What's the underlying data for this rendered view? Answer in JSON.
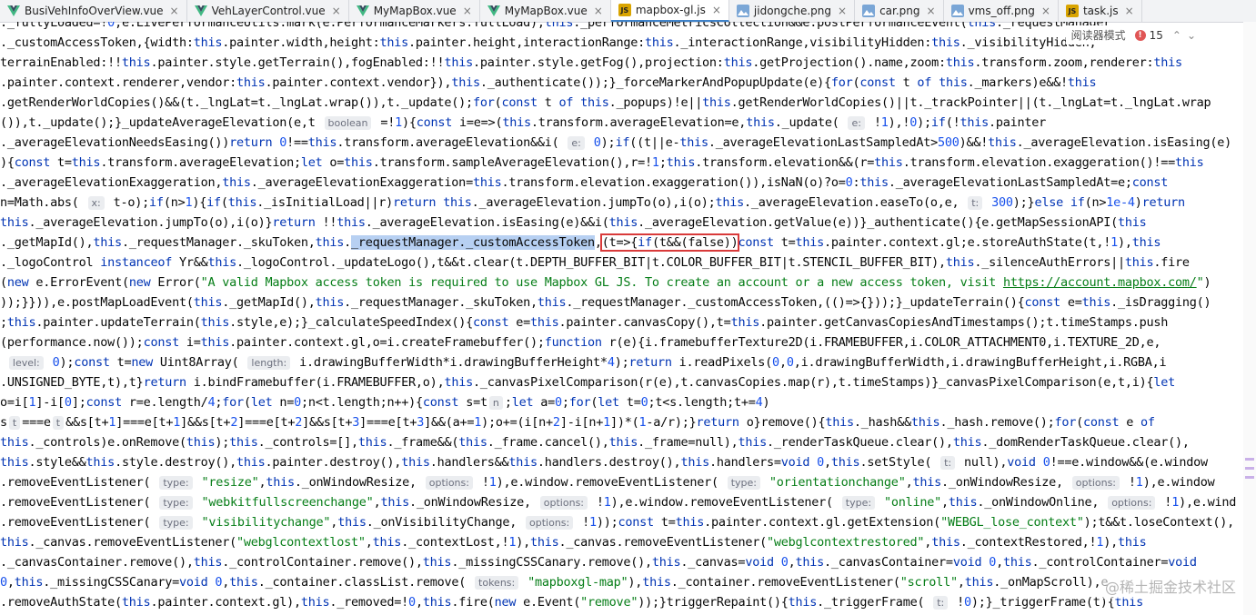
{
  "tabs": [
    {
      "label": "BusiVehInfoOverView.vue",
      "type": "vue",
      "active": false
    },
    {
      "label": "VehLayerControl.vue",
      "type": "vue",
      "active": false
    },
    {
      "label": "MyMapBox.vue",
      "type": "vue",
      "active": false
    },
    {
      "label": "MyMapBox.vue",
      "type": "vue",
      "active": false
    },
    {
      "label": "mapbox-gl.js",
      "type": "js",
      "active": true
    },
    {
      "label": "jidongche.png",
      "type": "png",
      "active": false
    },
    {
      "label": "car.png",
      "type": "png",
      "active": false
    },
    {
      "label": "vms_off.png",
      "type": "png",
      "active": false
    },
    {
      "label": "task.js",
      "type": "js",
      "active": false
    }
  ],
  "toolbar": {
    "reader_mode": "阅读器模式",
    "warnings_count": "15",
    "up_arrow": "⌃",
    "down_arrow": "⌄"
  },
  "code_lines": [
    "._fullyLoaded=!0,e.LivePerformanceUtils.mark(e.PerformanceMarkers.fullLoad),this._performanceMetricsCollection&&e.postPerformanceEvent(this._requestManager",
    "._customAccessToken,{width:this.painter.width,height:this.painter.height,interactionRange:this._interactionRange,visibilityHidden:this._visibilityHidden,",
    "terrainEnabled:!!this.painter.style.getTerrain(),fogEnabled:!!this.painter.style.getFog(),projection:this.getProjection().name,zoom:this.transform.zoom,renderer:this",
    ".painter.context.renderer,vendor:this.painter.context.vendor}),this._authenticate());}_forceMarkerAndPopupUpdate(e){for(const t of this._markers)e&&!this",
    ".getRenderWorldCopies()&&(t._lngLat=t._lngLat.wrap()),t._update();for(const t of this._popups)!e||this.getRenderWorldCopies()||t._trackPointer||(t._lngLat=t._lngLat.wrap",
    "()),t._update();}_updateAverageElevation(e,t [boolean] =!1){const i=e=>(this.transform.averageElevation=e,this._update( [e:] !1),!0);if(!this.painter",
    "._averageElevationNeedsEasing())return 0!==this.transform.averageElevation&&i( [e:] 0);if((t||e-this._averageElevationLastSampledAt>500)&&!this._averageElevation.isEasing(e)",
    "){const t=this.transform.averageElevation;let o=this.transform.sampleAverageElevation(),r=!1;this.transform.elevation&&(r=this.transform.elevation.exaggeration()!==this",
    "._averageElevationExaggeration,this._averageElevationExaggeration=this.transform.elevation.exaggeration()),isNaN(o)?o=0:this._averageElevationLastSampledAt=e;const",
    "n=Math.abs( [x:] t-o);if(n>1){if(this._isInitialLoad||r)return this._averageElevation.jumpTo(o),i(o);this._averageElevation.easeTo(o,e, [t:] 300);}else if(n>1e-4)return",
    "this._averageElevation.jumpTo(o),i(o)}return !!this._averageElevation.isEasing(e)&&i(this._averageElevation.getValue(e))}_authenticate(){e.getMapSessionAPI(this",
    "._getMapId(),this._requestManager._skuToken,this._requestManager._customAccessToken,(t=>{if(t&&(false))const t=this.painter.context.gl;e.storeAuthState(t,!1),this",
    "._logoControl instanceof Yr&&this._logoControl._updateLogo(),t&&t.clear(t.DEPTH_BUFFER_BIT|t.COLOR_BUFFER_BIT|t.STENCIL_BUFFER_BIT),this._silenceAuthErrors||this.fire",
    "(new e.ErrorEvent(new Error(\"A valid Mapbox access token is required to use Mapbox GL JS. To create an account or a new access token, visit https://account.mapbox.com/\")",
    "));}})),e.postMapLoadEvent(this._getMapId(),this._requestManager._skuToken,this._requestManager._customAccessToken,(()=>{}));}_updateTerrain(){const e=this._isDragging()",
    ";this.painter.updateTerrain(this.style,e);}_calculateSpeedIndex(){const e=this.painter.canvasCopy(),t=this.painter.getCanvasCopiesAndTimestamps();t.timeStamps.push",
    "(performance.now());const i=this.painter.context.gl,o=i.createFramebuffer();function r(e){i.framebufferTexture2D(i.FRAMEBUFFER,i.COLOR_ATTACHMENT0,i.TEXTURE_2D,e,",
    " [level:] 0);const t=new Uint8Array( [length:] i.drawingBufferWidth*i.drawingBufferHeight*4);return i.readPixels(0,0,i.drawingBufferWidth,i.drawingBufferHeight,i.RGBA,i",
    ".UNSIGNED_BYTE,t),t}return i.bindFramebuffer(i.FRAMEBUFFER,o),this._canvasPixelComparison(r(e),t.canvasCopies.map(r),t.timeStamps)}_canvasPixelComparison(e,t,i){let",
    "o=i[1]-i[0];const r=e.length/4;for(let n=0;n<t.length;n++){const s=t[n];let a=0;for(let t=0;t<s.length;t+=4)",
    "s[t]===e[t]&&s[t+1]===e[t+1]&&s[t+2]===e[t+2]&&s[t+3]===e[t+3]&&(a+=1);o+=(i[n+2]-i[n+1])*(1-a/r);}return o}remove(){this._hash&&this._hash.remove();for(const e of",
    "this._controls)e.onRemove(this);this._controls=[],this._frame&&(this._frame.cancel(),this._frame=null),this._renderTaskQueue.clear(),this._domRenderTaskQueue.clear(),",
    "this.style&&this.style.destroy(),this.painter.destroy(),this.handlers&&this.handlers.destroy(),this.handlers=void 0,this.setStyle( [t:] null),void 0!==e.window&&(e.window",
    ".removeEventListener( [type:] \"resize\",this._onWindowResize, [options:] !1),e.window.removeEventListener( [type:] \"orientationchange\",this._onWindowResize, [options:] !1),e.window",
    ".removeEventListener( [type:] \"webkitfullscreenchange\",this._onWindowResize, [options:] !1),e.window.removeEventListener( [type:] \"online\",this._onWindowOnline, [options:] !1),e.window",
    ".removeEventListener( [type:] \"visibilitychange\",this._onVisibilityChange, [options:] !1));const t=this.painter.context.gl.getExtension(\"WEBGL_lose_context\");t&&t.loseContext(),",
    "this._canvas.removeEventListener(\"webglcontextlost\",this._contextLost,!1),this._canvas.removeEventListener(\"webglcontextrestored\",this._contextRestored,!1),this",
    "._canvasContainer.remove(),this._controlContainer.remove(),this._missingCSSCanary.remove(),this._canvas=void 0,this._canvasContainer=void 0,this._controlContainer=void",
    "0,this._missingCSSCanary=void 0,this._container.classList.remove( [tokens:] \"mapboxgl-map\"),this._container.removeEventListener(\"scroll\",this._onMapScroll),e",
    ".removeAuthState(this.painter.context.gl),this._removed=!0,this.fire(new e.Event(\"remove\"));}triggerRepaint(){this._triggerFrame( [t:] !0);}_triggerFrame(t){this"
  ],
  "highlight": {
    "selected_text": "_requestManager._customAccessToken",
    "boxed_text": "(t=>{if(t&&(false))"
  },
  "watermark": "@稀土掘金技术社区"
}
